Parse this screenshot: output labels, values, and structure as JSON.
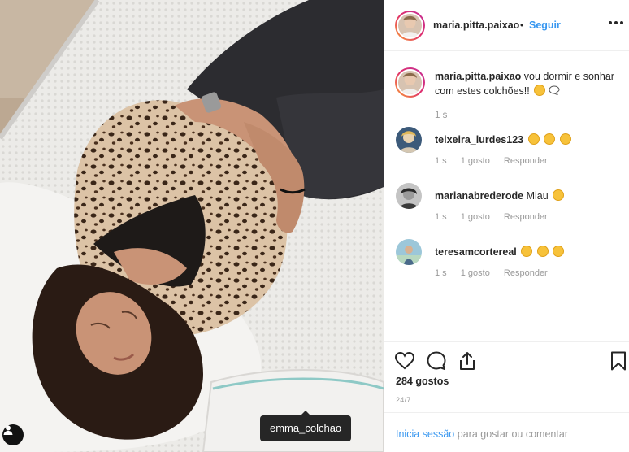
{
  "post": {
    "username": "maria.pitta.paixao",
    "separator": "•",
    "follow_label": "Seguir",
    "caption_text": "vou dormir e sonhar com estes colchões!!",
    "caption_time": "1 s",
    "photo_tag": "emma_colchao"
  },
  "comments": [
    {
      "username": "teixeira_lurdes123",
      "text": "",
      "time": "1 s",
      "likes": "1 gosto",
      "reply": "Responder"
    },
    {
      "username": "marianabrederode",
      "text": "Miau",
      "time": "1 s",
      "likes": "1 gosto",
      "reply": "Responder"
    },
    {
      "username": "teresamcortereal",
      "text": "",
      "time": "1 s",
      "likes": "1 gosto",
      "reply": "Responder"
    }
  ],
  "stats": {
    "likes": "284 gostos",
    "date": "24/7"
  },
  "login": {
    "link": "Inicia sessão",
    "rest": "para gostar ou comentar"
  },
  "icons": {
    "more": "more-options-icon",
    "like": "heart-icon",
    "comment": "comment-icon",
    "share": "share-icon",
    "save": "bookmark-icon",
    "user_tag": "user-icon"
  },
  "colors": {
    "link": "#3897f0",
    "text": "#262626",
    "muted": "#999999",
    "tag_bg": "#262626"
  }
}
